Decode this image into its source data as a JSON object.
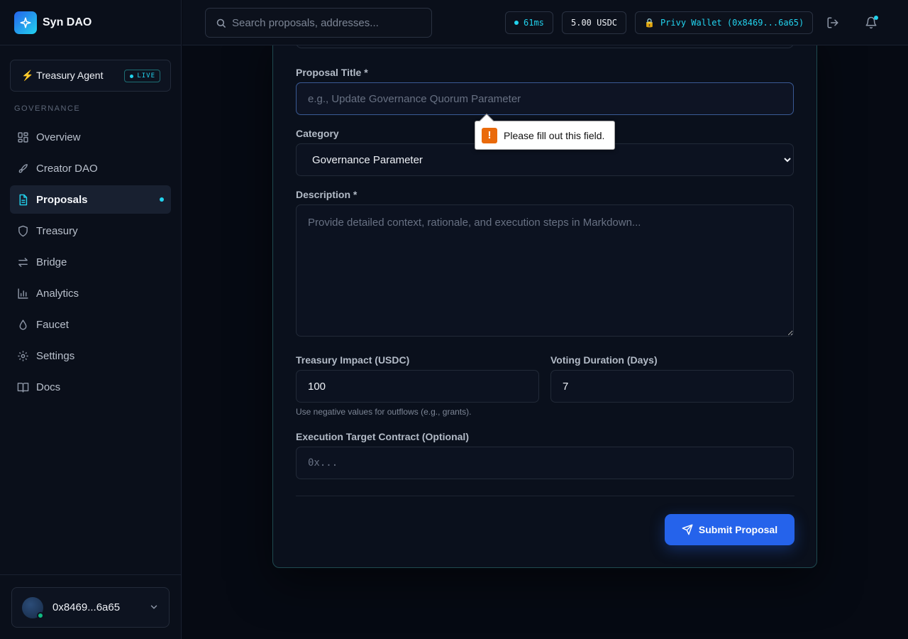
{
  "brand": {
    "name": "Syn DAO",
    "logo_icon": "sparkle-icon"
  },
  "agent": {
    "label": "⚡ Treasury Agent",
    "badge": "LIVE"
  },
  "sidebar": {
    "section_label": "GOVERNANCE",
    "items": [
      {
        "label": "Overview",
        "icon": "layout-grid-icon",
        "active": false
      },
      {
        "label": "Creator DAO",
        "icon": "rocket-icon",
        "active": false
      },
      {
        "label": "Proposals",
        "icon": "file-text-icon",
        "active": true
      },
      {
        "label": "Treasury",
        "icon": "shield-icon",
        "active": false
      },
      {
        "label": "Bridge",
        "icon": "arrows-swap-icon",
        "active": false
      },
      {
        "label": "Analytics",
        "icon": "bar-chart-icon",
        "active": false
      },
      {
        "label": "Faucet",
        "icon": "droplet-icon",
        "active": false
      },
      {
        "label": "Settings",
        "icon": "gear-icon",
        "active": false
      },
      {
        "label": "Docs",
        "icon": "book-icon",
        "active": false
      }
    ],
    "account": {
      "address": "0x8469...6a65"
    }
  },
  "topbar": {
    "search_placeholder": "Search proposals, addresses...",
    "latency": "61ms",
    "balance": "5.00 USDC",
    "wallet": "Privy Wallet (0x8469...6a65)"
  },
  "form": {
    "title_label": "Proposal Title *",
    "title_placeholder": "e.g., Update Governance Quorum Parameter",
    "title_value": "",
    "category_label": "Category",
    "category_value": "Governance Parameter",
    "description_label": "Description *",
    "description_placeholder": "Provide detailed context, rationale, and execution steps in Markdown...",
    "treasury_label": "Treasury Impact (USDC)",
    "treasury_value": "100",
    "treasury_hint": "Use negative values for outflows (e.g., grants).",
    "duration_label": "Voting Duration (Days)",
    "duration_value": "7",
    "target_label": "Execution Target Contract (Optional)",
    "target_placeholder": "0x...",
    "submit_label": "Submit Proposal"
  },
  "validation": {
    "message": "Please fill out this field."
  },
  "colors": {
    "accent": "#22d3ee",
    "primary": "#2563eb",
    "background": "#060a13",
    "warning": "#ea6a0b"
  }
}
